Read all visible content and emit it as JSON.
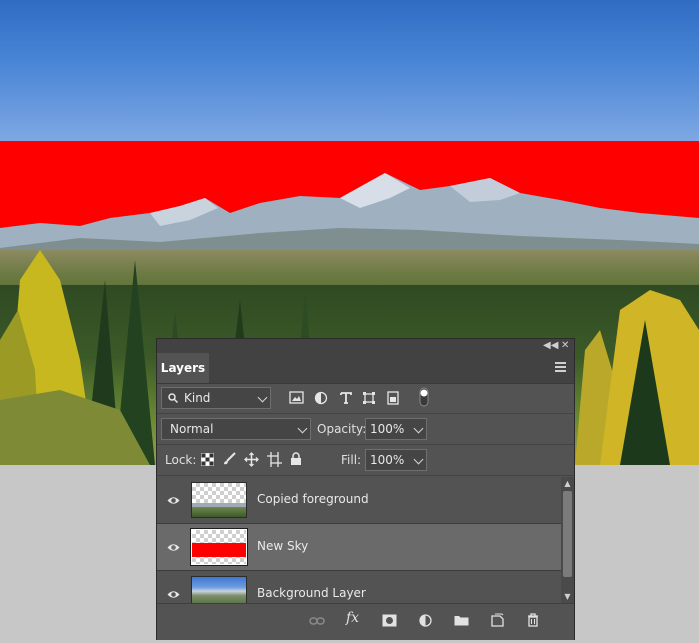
{
  "panel": {
    "tab_label": "Layers",
    "filter": {
      "icon": "search-icon",
      "value": "Kind"
    },
    "blend_mode": "Normal",
    "opacity_label": "Opacity:",
    "opacity_value": "100%",
    "lock_label": "Lock:",
    "fill_label": "Fill:",
    "fill_value": "100%"
  },
  "layers": [
    {
      "name": "Copied foreground",
      "visible": true,
      "selected": false,
      "thumbnail": "transparent-with-foreground"
    },
    {
      "name": "New Sky",
      "visible": true,
      "selected": true,
      "thumbnail": "red-fill"
    },
    {
      "name": "Background Layer",
      "visible": true,
      "selected": false,
      "thumbnail": "landscape-photo"
    }
  ],
  "colors": {
    "panel_bg": "#535353",
    "selected_row": "#6a6a6a",
    "sky_fill": "#ff0000",
    "canvas_bg": "#c7c7c7"
  },
  "filter_icons": [
    "image-filter-icon",
    "adjustment-filter-icon",
    "type-filter-icon",
    "shape-filter-icon",
    "smart-object-filter-icon",
    "filter-toggle-icon"
  ],
  "lock_icons": [
    "lock-transparent-pixels-icon",
    "lock-image-pixels-icon",
    "lock-position-icon",
    "lock-artboard-icon",
    "lock-all-icon"
  ],
  "footer_icons": [
    "link-layers-icon",
    "fx-icon",
    "add-mask-icon",
    "adjustment-layer-icon",
    "new-group-icon",
    "new-layer-icon",
    "delete-layer-icon"
  ],
  "footer_fx_text": "fx"
}
